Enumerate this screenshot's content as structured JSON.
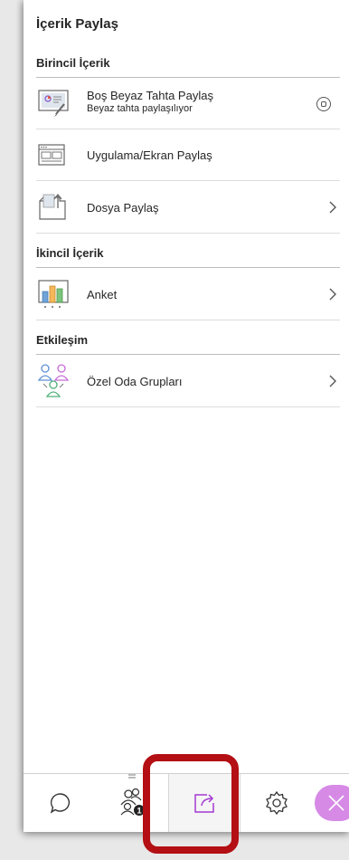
{
  "panel": {
    "title": "İçerik Paylaş"
  },
  "sections": {
    "primary": {
      "heading": "Birincil İçerik",
      "items": [
        {
          "label": "Boş Beyaz Tahta Paylaş",
          "sublabel": "Beyaz tahta paylaşılıyor",
          "icon": "whiteboard-icon",
          "action_icon": "stop-sharing-icon"
        },
        {
          "label": "Uygulama/Ekran Paylaş",
          "icon": "screen-share-icon"
        },
        {
          "label": "Dosya Paylaş",
          "icon": "file-share-icon",
          "action_icon": "chevron-right-icon"
        }
      ]
    },
    "secondary": {
      "heading": "İkincil İçerik",
      "items": [
        {
          "label": "Anket",
          "icon": "poll-chart-icon",
          "action_icon": "chevron-right-icon"
        }
      ]
    },
    "interaction": {
      "heading": "Etkileşim",
      "items": [
        {
          "label": "Özel Oda Grupları",
          "icon": "breakout-groups-icon",
          "action_icon": "chevron-right-icon"
        }
      ]
    }
  },
  "bottom_bar": {
    "tabs": [
      {
        "icon": "chat-icon"
      },
      {
        "icon": "attendees-icon"
      },
      {
        "icon": "share-content-icon",
        "active": true
      },
      {
        "icon": "settings-icon"
      },
      {
        "icon": "close-icon"
      }
    ]
  },
  "colors": {
    "accent": "#a020c8",
    "active_tab_icon": "#a43bd2",
    "close_fab": "#d68ae6",
    "highlight_frame": "#b30f14",
    "text": "#262626"
  }
}
